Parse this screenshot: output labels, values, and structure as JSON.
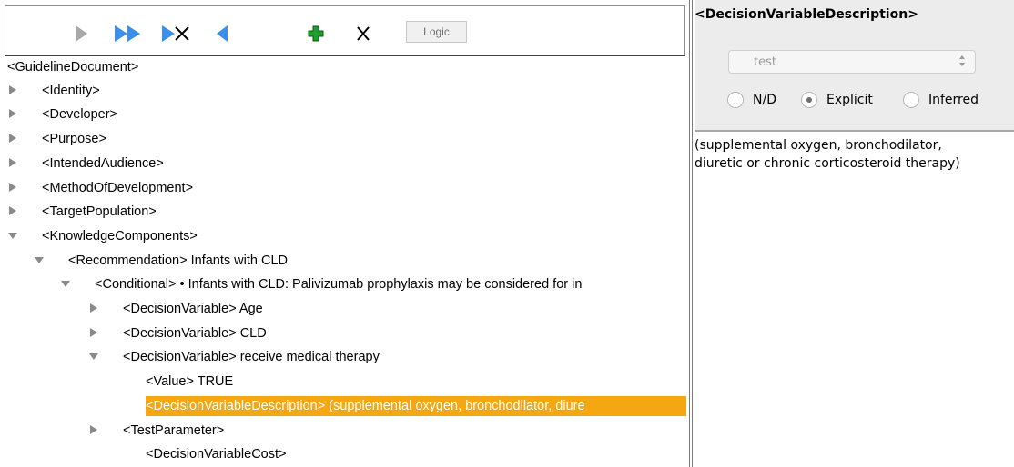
{
  "toolbar": {
    "buttons": [
      {
        "name": "play-icon",
        "enabled": false
      },
      {
        "name": "fast-forward-icon",
        "enabled": true
      },
      {
        "name": "skip-delete-icon",
        "enabled": true
      },
      {
        "name": "back-icon",
        "enabled": true
      },
      {
        "name": "add-icon",
        "enabled": true
      },
      {
        "name": "delete-icon",
        "enabled": true
      }
    ],
    "logic_label": "Logic"
  },
  "tree": {
    "root": "<GuidelineDocument>",
    "items": [
      {
        "label": "<Identity>",
        "expanded": false
      },
      {
        "label": "<Developer>",
        "expanded": false
      },
      {
        "label": "<Purpose>",
        "expanded": false
      },
      {
        "label": "<IntendedAudience>",
        "expanded": false
      },
      {
        "label": "<MethodOfDevelopment>",
        "expanded": false
      },
      {
        "label": "<TargetPopulation>",
        "expanded": false
      },
      {
        "label": "<KnowledgeComponents>",
        "expanded": true
      },
      {
        "label": "<Recommendation> Infants with CLD",
        "expanded": true
      },
      {
        "label": "<Conditional> • Infants with CLD: Palivizumab prophylaxis may be considered for in",
        "expanded": true
      },
      {
        "label": "<DecisionVariable> Age",
        "expanded": false
      },
      {
        "label": "<DecisionVariable> CLD",
        "expanded": false
      },
      {
        "label": "<DecisionVariable> receive medical therapy",
        "expanded": true
      },
      {
        "label": "<Value> TRUE",
        "leaf": true
      },
      {
        "label": "<DecisionVariableDescription> (supplemental oxygen, bronchodilator, diure",
        "leaf": true,
        "selected": true
      },
      {
        "label": "<TestParameter>",
        "expanded": false
      },
      {
        "label": "<DecisionVariableCost>",
        "leaf": true
      }
    ]
  },
  "detail": {
    "title": "<DecisionVariableDescription>",
    "select_value": "test",
    "radios": [
      {
        "label": "N/D",
        "checked": false
      },
      {
        "label": "Explicit",
        "checked": true
      },
      {
        "label": "Inferred",
        "checked": false
      }
    ],
    "text_lines": [
      "(supplemental oxygen, bronchodilator,",
      "diuretic or chronic corticosteroid  therapy)"
    ]
  },
  "colors": {
    "selection": "#f5a712",
    "arrow_blue": "#3c8fe9",
    "arrow_gray": "#a8a8a8",
    "plus_green": "#1e9e2c"
  }
}
